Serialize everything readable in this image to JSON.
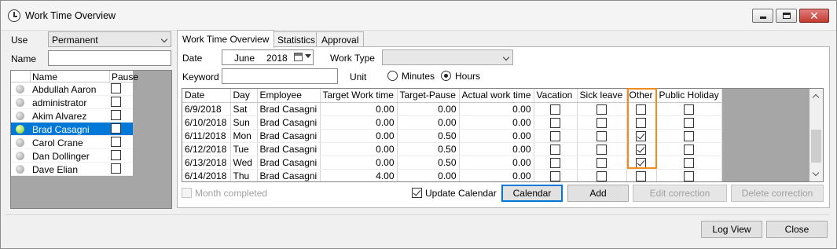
{
  "window": {
    "title": "Work Time Overview"
  },
  "left_panel": {
    "use_label": "Use",
    "use_value": "Permanent",
    "name_label": "Name",
    "name_value": "",
    "columns": {
      "name": "Name",
      "pause": "Pause"
    },
    "employees": [
      {
        "name": "Abdullah Aaron",
        "pause": false,
        "selected": false
      },
      {
        "name": "administrator",
        "pause": false,
        "selected": false
      },
      {
        "name": "Akim Alvarez",
        "pause": false,
        "selected": false
      },
      {
        "name": "Brad Casagni",
        "pause": false,
        "selected": true
      },
      {
        "name": "Carol Crane",
        "pause": false,
        "selected": false
      },
      {
        "name": "Dan Dollinger",
        "pause": false,
        "selected": false
      },
      {
        "name": "Dave Elian",
        "pause": false,
        "selected": false
      }
    ]
  },
  "tabs": [
    {
      "label": "Work Time Overview",
      "active": true
    },
    {
      "label": "Statistics",
      "active": false
    },
    {
      "label": "Approval",
      "active": false
    }
  ],
  "filters": {
    "date_label": "Date",
    "date_month": "June",
    "date_year": "2018",
    "work_type_label": "Work Type",
    "work_type_value": "",
    "keyword_label": "Keyword",
    "keyword_value": "",
    "unit_label": "Unit",
    "unit_minutes": "Minutes",
    "unit_hours": "Hours",
    "unit_selected": "Hours"
  },
  "grid": {
    "columns": [
      "Date",
      "Day",
      "Employee",
      "Target Work time",
      "Target-Pause",
      "Actual work time",
      "Vacation",
      "Sick leave",
      "Other",
      "Public Holiday"
    ],
    "rows": [
      {
        "date": "6/9/2018",
        "day": "Sat",
        "employee": "Brad Casagni",
        "target": "0.00",
        "target_pause": "0.00",
        "actual": "0.00",
        "vacation": false,
        "sick": false,
        "other": false,
        "holiday": false
      },
      {
        "date": "6/10/2018",
        "day": "Sun",
        "employee": "Brad Casagni",
        "target": "0.00",
        "target_pause": "0.00",
        "actual": "0.00",
        "vacation": false,
        "sick": false,
        "other": false,
        "holiday": false
      },
      {
        "date": "6/11/2018",
        "day": "Mon",
        "employee": "Brad Casagni",
        "target": "0.00",
        "target_pause": "0.50",
        "actual": "0.00",
        "vacation": false,
        "sick": false,
        "other": true,
        "holiday": false
      },
      {
        "date": "6/12/2018",
        "day": "Tue",
        "employee": "Brad Casagni",
        "target": "0.00",
        "target_pause": "0.50",
        "actual": "0.00",
        "vacation": false,
        "sick": false,
        "other": true,
        "holiday": false
      },
      {
        "date": "6/13/2018",
        "day": "Wed",
        "employee": "Brad Casagni",
        "target": "0.00",
        "target_pause": "0.50",
        "actual": "0.00",
        "vacation": false,
        "sick": false,
        "other": true,
        "holiday": false
      },
      {
        "date": "6/14/2018",
        "day": "Thu",
        "employee": "Brad Casagni",
        "target": "4.00",
        "target_pause": "0.00",
        "actual": "0.00",
        "vacation": false,
        "sick": false,
        "other": false,
        "holiday": false
      }
    ]
  },
  "actions": {
    "month_completed": "Month completed",
    "update_calendar": "Update Calendar",
    "calendar": "Calendar",
    "add": "Add",
    "edit_correction": "Edit correction",
    "delete_correction": "Delete correction"
  },
  "footer": {
    "log_view": "Log View",
    "close": "Close"
  },
  "colors": {
    "selection": "#0078d7",
    "highlight": "#f08c1e"
  },
  "icons": {
    "title": "clock-icon",
    "date_picker": "calendar-icon"
  }
}
